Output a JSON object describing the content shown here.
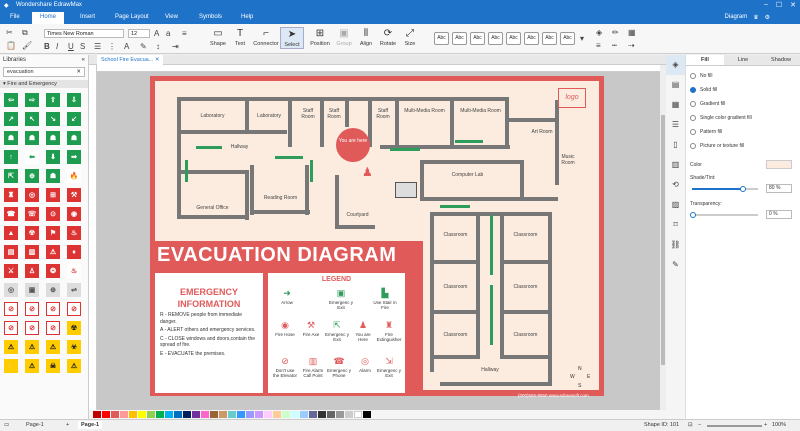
{
  "app": {
    "title": "Wondershare EdrawMax"
  },
  "menu": {
    "file": "File",
    "home": "Home",
    "insert": "Insert",
    "page_layout": "Page Layout",
    "view": "View",
    "symbols": "Symbols",
    "help": "Help",
    "diagram": "Diagram"
  },
  "ribbon": {
    "font": "Times New Roman",
    "size": "12",
    "shape": "Shape",
    "text": "Text",
    "connector": "Connector",
    "select": "Select",
    "position": "Position",
    "group": "Group",
    "align": "Align",
    "rotate": "Rotate",
    "size_label": "Size",
    "style_label": "Abc"
  },
  "left": {
    "libraries": "Libraries",
    "search": "evacuation",
    "category": "Fire and Emergency"
  },
  "doc_tab": "School Fire Evacua...",
  "diagram": {
    "rooms": {
      "laboratory1": "Laboratory",
      "laboratory2": "Laboratory",
      "staff1": "Staff Room",
      "staff2": "Staff Room",
      "staff3": "Staff Room",
      "mm1": "Multi-Media Room",
      "mm2": "Multi-Media Room",
      "art": "Art Room",
      "music": "Music Room",
      "hallway1": "Hallway",
      "you_are_here": "You are here",
      "reading": "Reading Room",
      "general": "General Office",
      "computer": "Computer Lab",
      "courtyard": "Courtyard",
      "classroom": "Classroom",
      "hallway2": "Hallway",
      "north": "N",
      "south": "S",
      "west": "W",
      "east": "E",
      "logo": "logo"
    },
    "title": "EVACUATION DIAGRAM",
    "emergency": {
      "title1": "EMERGENCY",
      "title2": "INFORMATION",
      "r": "R - REMOVE people from immediate danger.",
      "a": "A - ALERT others and emergency services.",
      "c": "C - CLOSE windows and doors,contain the spread of fire.",
      "e": "E - EVACUATE the premises."
    },
    "legend": {
      "title": "LEGEND",
      "items": [
        "Arrow",
        "Emergenc y Exit",
        "Use Stair in Fire",
        "Fire Hose",
        "Fire Axe",
        "Emergenc y Exit",
        "You are Here",
        "Fire Extinguisher",
        "Don't use the Elevator",
        "Fire Alarm Call Point",
        "Emergenc y Phone",
        "Alarm",
        "Emergenc y Exit"
      ]
    },
    "contact": "(000)555-9550 www.edrawsoft.com"
  },
  "status": {
    "page_tab": "Page-1",
    "page_active": "Page-1",
    "shape_id": "Shape ID: 101",
    "zoom": "100%"
  },
  "panel": {
    "tabs": [
      "Fill",
      "Line",
      "Shadow"
    ],
    "options": [
      "No fill",
      "Solid fill",
      "Gradient fill",
      "Single color gradient fill",
      "Pattern fill",
      "Picture or texture fill"
    ],
    "color": "Color",
    "shade": "Shade/Tint:",
    "shade_val": "80 %",
    "transparency": "Transparency:",
    "trans_val": "0 %"
  },
  "colors": {
    "brand": "#1e73c9",
    "poster": "#e05a5a",
    "floor": "#fbecdf",
    "green": "#2e9c5a"
  }
}
